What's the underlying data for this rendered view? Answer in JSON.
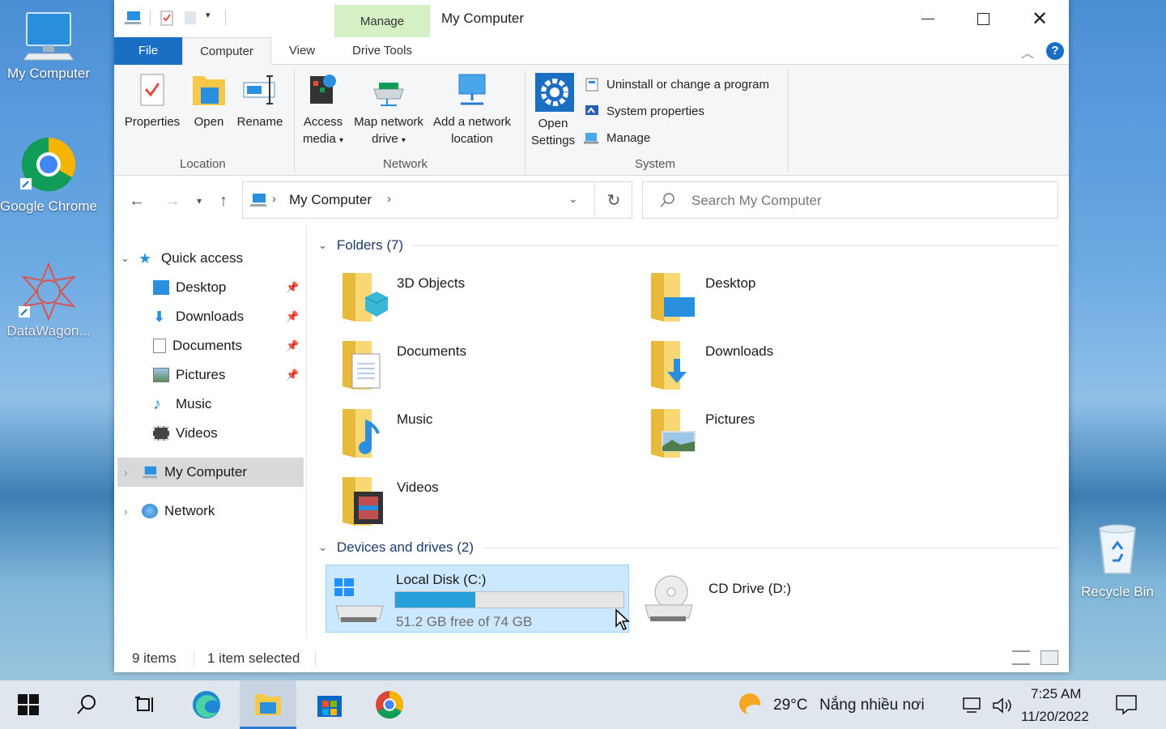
{
  "desktop": {
    "icons": [
      {
        "label": "My Computer",
        "icon": "computer-icon"
      },
      {
        "label": "Google Chrome",
        "icon": "chrome-icon"
      },
      {
        "label": "DataWagon...",
        "icon": "datawagon-icon"
      },
      {
        "label": "Recycle Bin",
        "icon": "recycle-bin-icon"
      }
    ]
  },
  "window": {
    "title": "My Computer",
    "manage_tab": "Manage",
    "tabs": {
      "file": "File",
      "computer": "Computer",
      "view": "View",
      "drive_tools": "Drive Tools"
    },
    "ribbon": {
      "location": {
        "label": "Location",
        "properties": "Properties",
        "open": "Open",
        "rename": "Rename"
      },
      "network": {
        "label": "Network",
        "access_media_1": "Access",
        "access_media_2": "media",
        "map_drive_1": "Map network",
        "map_drive_2": "drive",
        "add_location_1": "Add a network",
        "add_location_2": "location"
      },
      "system": {
        "label": "System",
        "open_settings_1": "Open",
        "open_settings_2": "Settings",
        "uninstall": "Uninstall or change a program",
        "system_properties": "System properties",
        "manage": "Manage"
      }
    },
    "address": {
      "path": "My Computer",
      "search_placeholder": "Search My Computer"
    },
    "nav": {
      "quick_access": "Quick access",
      "items": [
        "Desktop",
        "Downloads",
        "Documents",
        "Pictures",
        "Music",
        "Videos"
      ],
      "my_computer": "My Computer",
      "network": "Network"
    },
    "folders_header": "Folders (7)",
    "folders": [
      "3D Objects",
      "Desktop",
      "Documents",
      "Downloads",
      "Music",
      "Pictures",
      "Videos"
    ],
    "devices_header": "Devices and drives (2)",
    "drives": {
      "c": {
        "name": "Local Disk (C:)",
        "free": "51.2 GB free of 7​4 GB",
        "used_fraction": 0.35
      },
      "d": {
        "name": "CD Drive (D:)"
      }
    },
    "status": {
      "items": "9 items",
      "selected": "1 item selected"
    }
  },
  "taskbar": {
    "weather": {
      "temp": "29°C",
      "desc": "Nắng nhiều nơi"
    },
    "time": "7:25 AM",
    "date": "11/20/2022"
  },
  "colors": {
    "accent": "#1a6fc4",
    "selection": "#cce8ff",
    "manage_tab": "#d6f0c5"
  }
}
